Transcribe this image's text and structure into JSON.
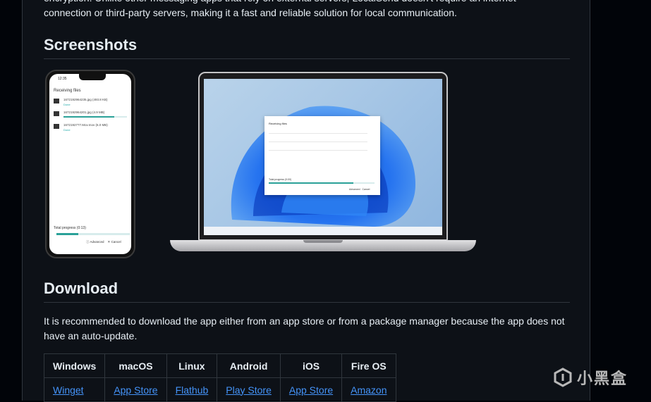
{
  "intro": {
    "line1": "encryption. Unlike other messaging apps that rely on external servers, LocalSend doesn't require an internet",
    "line2": "connection or third-party servers, making it a fast and reliable solution for local communication."
  },
  "screenshots": {
    "heading": "Screenshots",
    "phone": {
      "time": "12:35",
      "title": "Receiving files",
      "files": [
        {
          "name": "1672192964235.jpg (493.8 KB)",
          "status": "Done",
          "progress": 1.0
        },
        {
          "name": "1672192964201.jpg (4.9 MB)",
          "status": "",
          "progress": 0.8
        },
        {
          "name": "1672192777.Mov.mov (6.0 MB)",
          "status": "Done",
          "progress": 1.0
        }
      ],
      "total_label": "Total progress (0:13)",
      "total_progress": 0.3,
      "advanced": "Advanced",
      "cancel": "Cancel"
    },
    "laptop": {
      "dialog_title": "Receiving files",
      "total_label": "Total progress (0:00)",
      "total_progress": 0.8,
      "advanced": "Advanced",
      "cancel": "Cancel"
    }
  },
  "download": {
    "heading": "Download",
    "paragraph": "It is recommended to download the app either from an app store or from a package manager because the app does not have an auto-update.",
    "table": {
      "headers": [
        "Windows",
        "macOS",
        "Linux",
        "Android",
        "iOS",
        "Fire OS"
      ],
      "links": [
        "Winget",
        "App Store",
        "Flathub",
        "Play Store",
        "App Store",
        "Amazon"
      ]
    }
  },
  "watermark": {
    "text": "小黑盒"
  }
}
